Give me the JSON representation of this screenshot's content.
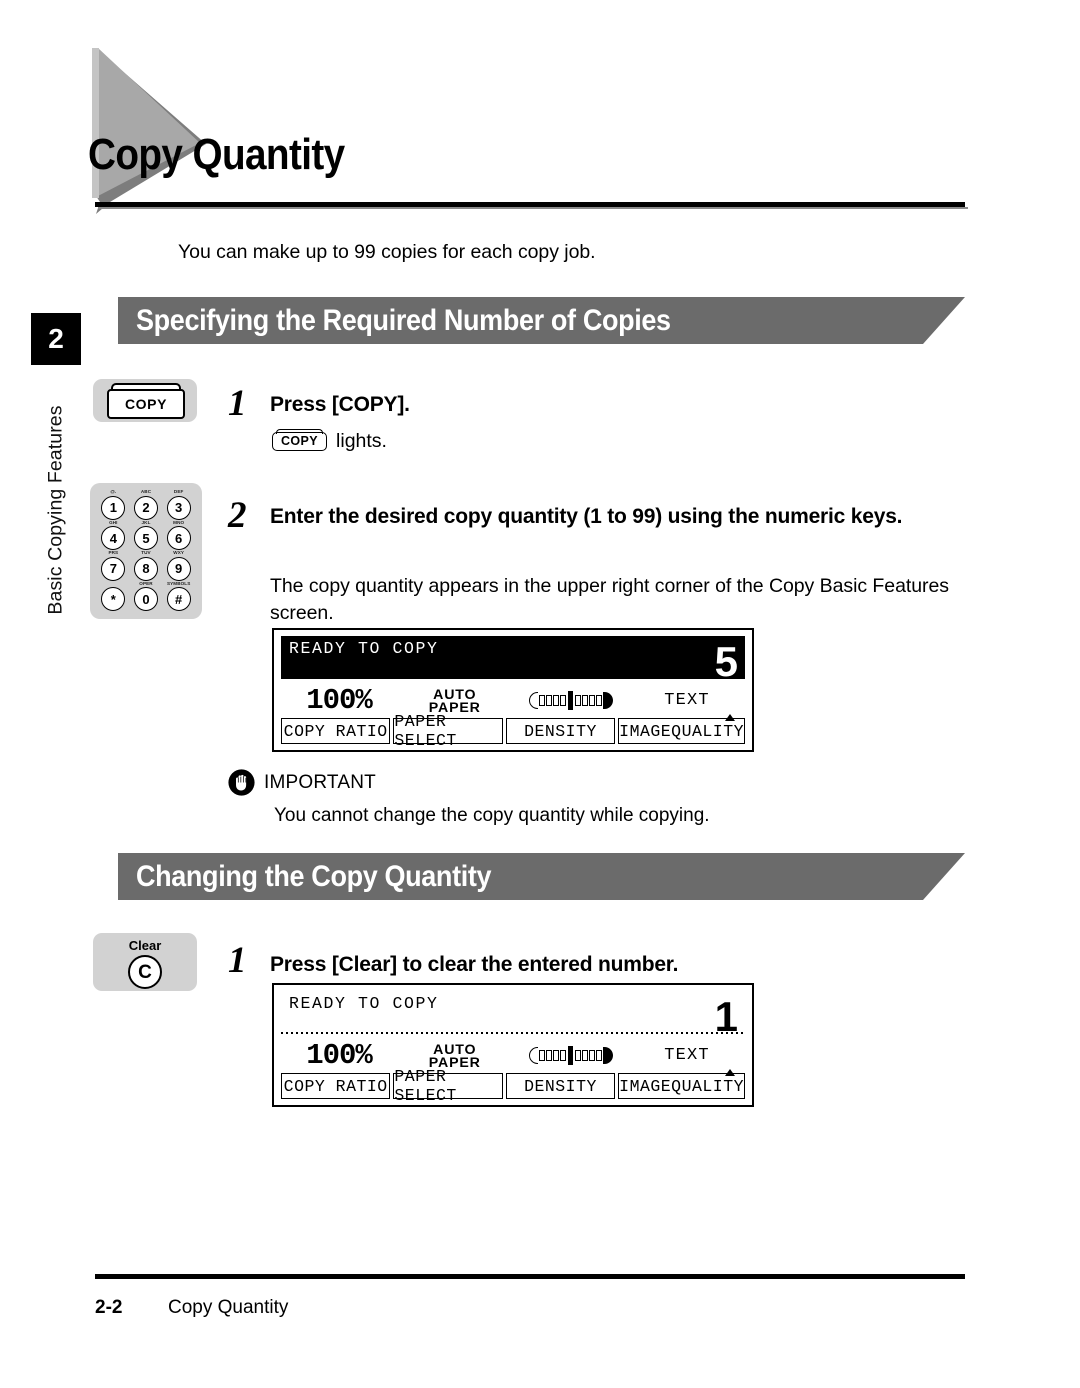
{
  "page": {
    "title": "Copy Quantity",
    "intro": "You can make up to 99 copies for each copy job.",
    "chapter_number": "2",
    "running_head": "Basic Copying Features"
  },
  "sections": [
    {
      "heading": "Specifying the Required Number of Copies"
    },
    {
      "heading": "Changing the Copy Quantity"
    }
  ],
  "steps": {
    "s1": {
      "number": "1",
      "heading": "Press [COPY].",
      "key_label": "COPY",
      "inline_key": "COPY",
      "lights_text": "lights."
    },
    "s2": {
      "number": "2",
      "heading": "Enter the desired copy quantity (1 to 99) using the numeric keys.",
      "body": "The copy quantity appears in the upper right corner of the Copy Basic Features screen."
    },
    "s3": {
      "number": "1",
      "heading": "Press [Clear] to clear the entered number.",
      "key_label": "Clear",
      "key_glyph": "C"
    }
  },
  "keypad": {
    "keys": [
      {
        "digit": "1",
        "sub": "@."
      },
      {
        "digit": "2",
        "sub": "ABC"
      },
      {
        "digit": "3",
        "sub": "DEF"
      },
      {
        "digit": "4",
        "sub": "GHI"
      },
      {
        "digit": "5",
        "sub": "JKL"
      },
      {
        "digit": "6",
        "sub": "MNO"
      },
      {
        "digit": "7",
        "sub": "PRS"
      },
      {
        "digit": "8",
        "sub": "TUV"
      },
      {
        "digit": "9",
        "sub": "WXY"
      },
      {
        "digit": "*",
        "sub": ""
      },
      {
        "digit": "0",
        "sub": "OPER"
      },
      {
        "digit": "#",
        "sub": "SYMBOLS"
      }
    ]
  },
  "note": {
    "title": "IMPORTANT",
    "body": "You cannot change the copy quantity while copying.",
    "icon": "hand-icon"
  },
  "lcd_1": {
    "status": "READY TO COPY",
    "quantity": "5",
    "inverted": true,
    "copy_ratio_value": "100%",
    "paper_select_value_line1": "AUTO",
    "paper_select_value_line2": "PAPER",
    "image_quality_value": "TEXT",
    "buttons": [
      "COPY RATIO",
      "PAPER SELECT",
      "DENSITY",
      "IMAGEQUALITY"
    ]
  },
  "lcd_2": {
    "status": "READY TO COPY",
    "quantity": "1",
    "inverted": false,
    "copy_ratio_value": "100%",
    "paper_select_value_line1": "AUTO",
    "paper_select_value_line2": "PAPER",
    "image_quality_value": "TEXT",
    "buttons": [
      "COPY RATIO",
      "PAPER SELECT",
      "DENSITY",
      "IMAGEQUALITY"
    ]
  },
  "footer": {
    "page_number": "2-2",
    "title": "Copy Quantity"
  },
  "colors": {
    "section_bar": "#6b6b6b",
    "key_illustration": "#d2d2d2",
    "title_triangle": "#9e9e9e",
    "chapter_tab": "#000000"
  }
}
